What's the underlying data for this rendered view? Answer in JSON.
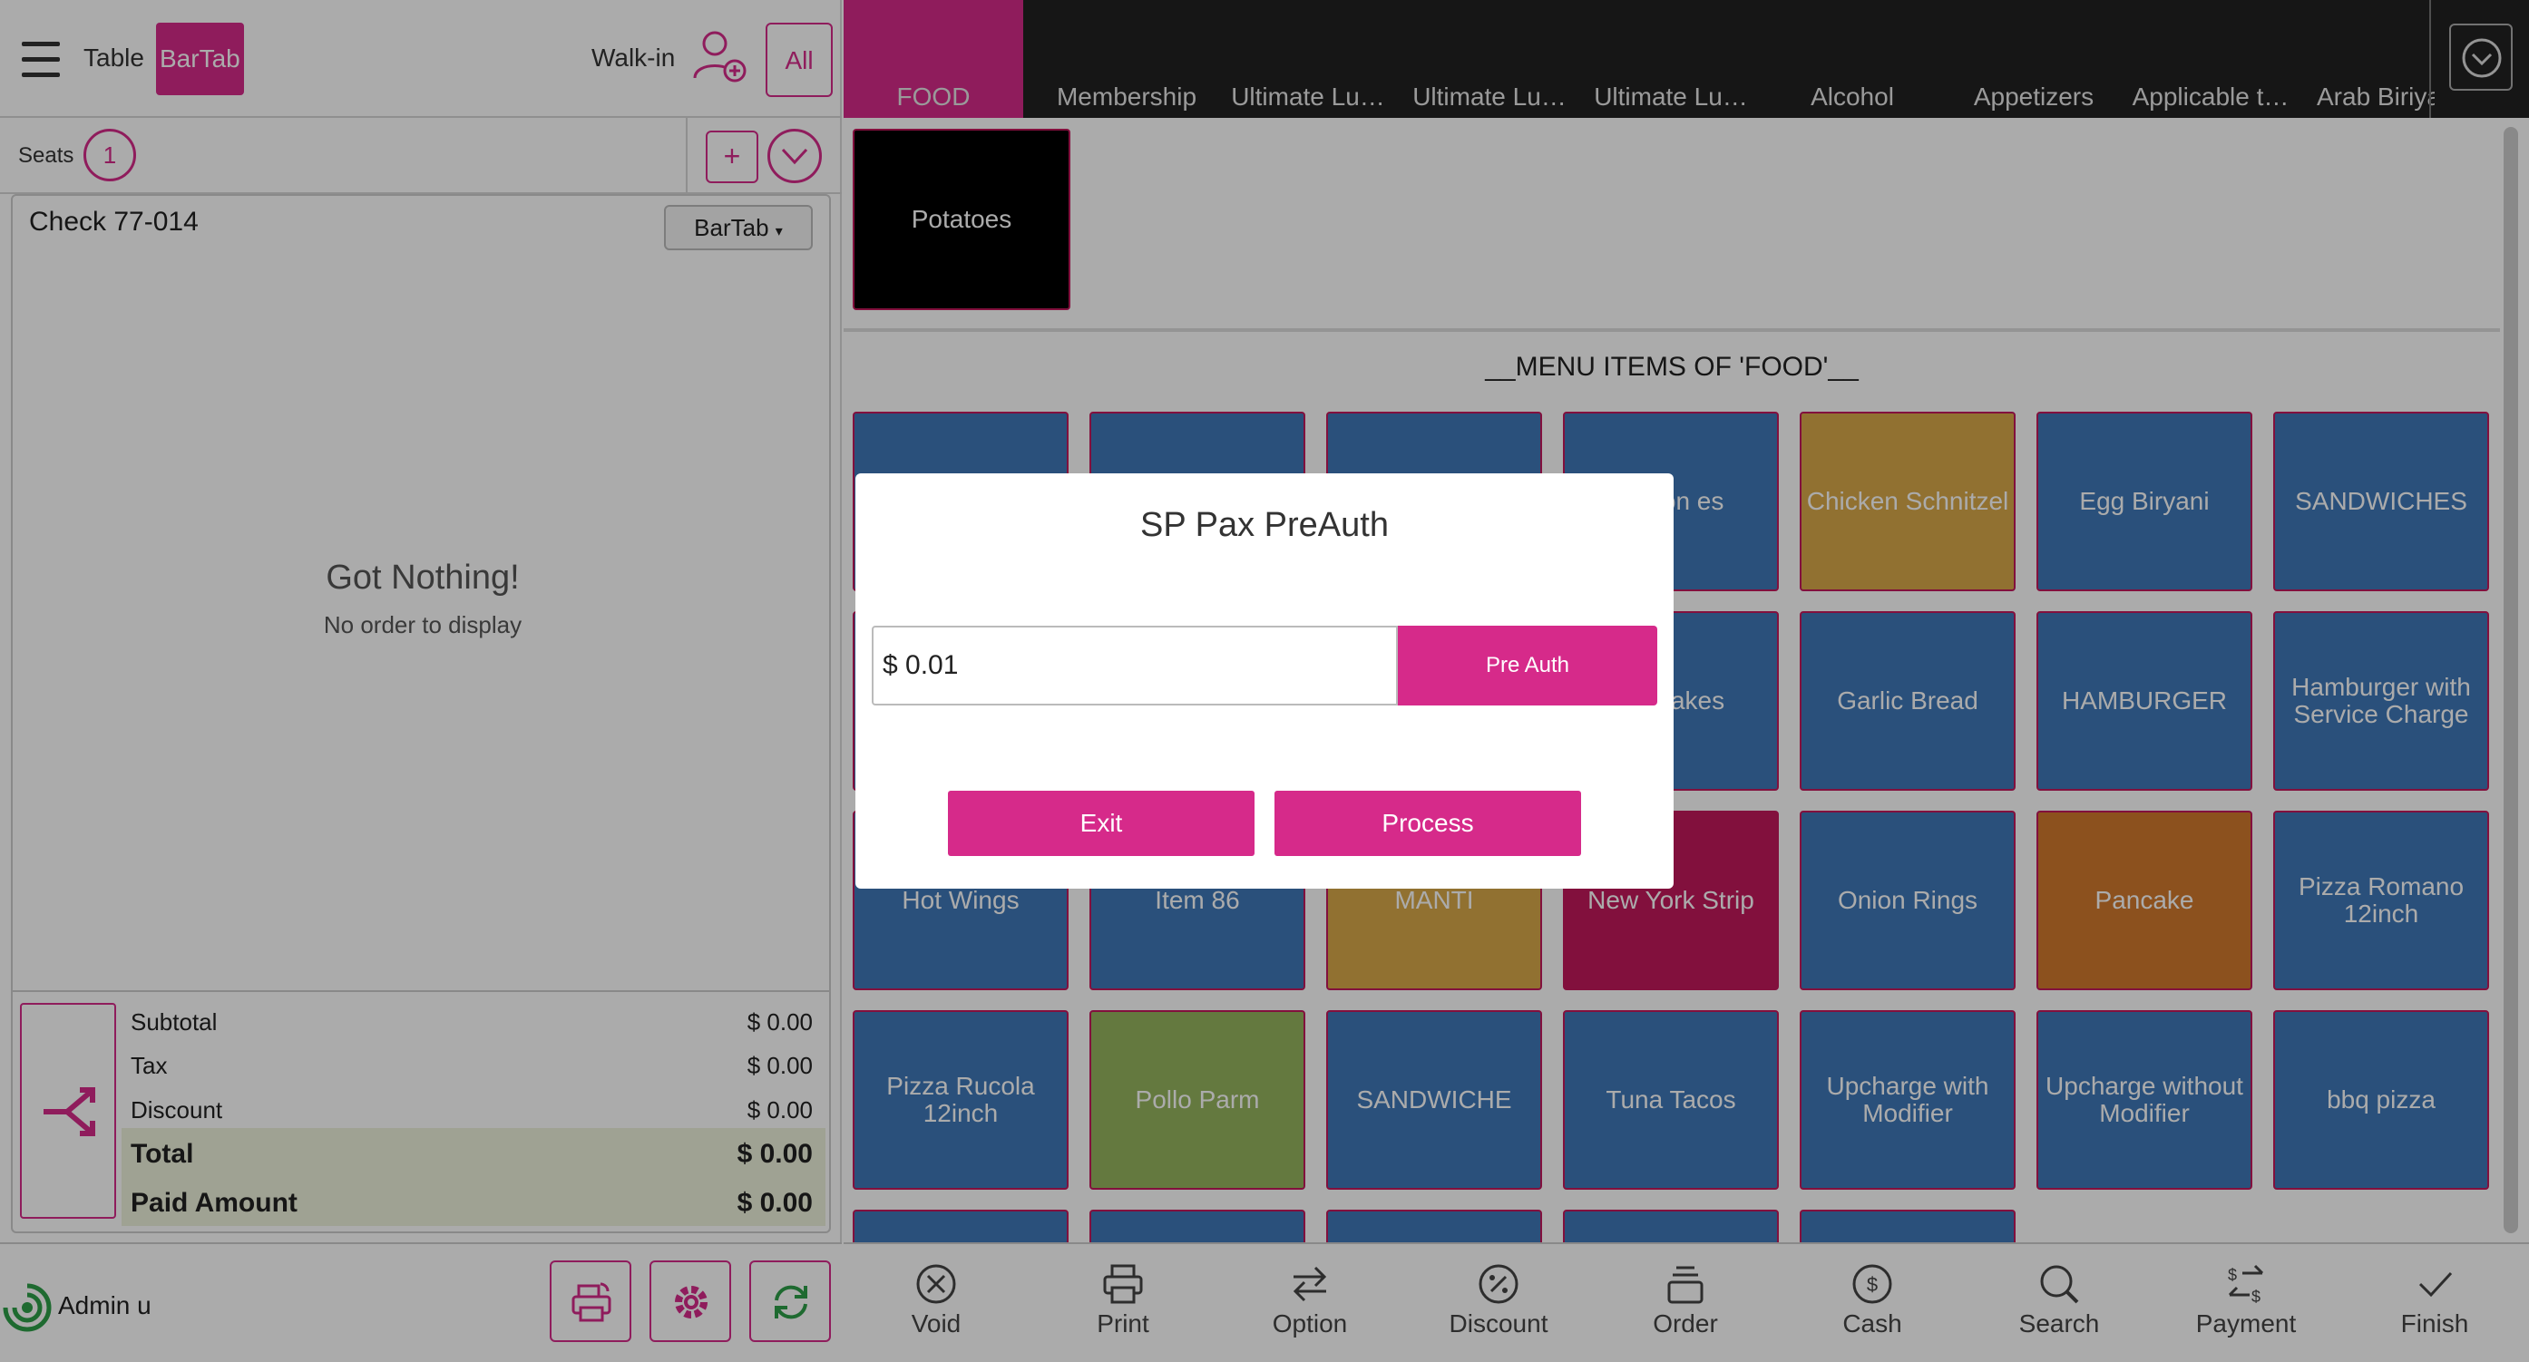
{
  "header": {
    "table_label": "Table",
    "bartab_label": "BarTab",
    "walkin_label": "Walk-in",
    "all_label": "All"
  },
  "seats": {
    "label": "Seats",
    "count": "1",
    "add_symbol": "+"
  },
  "check": {
    "title": "Check 77-014",
    "type": "BarTab",
    "empty_title": "Got Nothing!",
    "empty_sub": "No order to display"
  },
  "totals": {
    "subtotal_label": "Subtotal",
    "subtotal": "$ 0.00",
    "tax_label": "Tax",
    "tax": "$ 0.00",
    "discount_label": "Discount",
    "discount": "$ 0.00",
    "total_label": "Total",
    "total": "$ 0.00",
    "paid_label": "Paid Amount",
    "paid": "$ 0.00"
  },
  "user": {
    "name": "Admin u"
  },
  "tabs": [
    "FOOD",
    "Membership",
    "Ultimate Lu…",
    "Ultimate Lu…",
    "Ultimate Lu…",
    "Alcohol",
    "Appetizers",
    "Applicable t…",
    "Arab Biriya"
  ],
  "category": {
    "item": "Potatoes"
  },
  "menu": {
    "heading": "__MENU ITEMS OF 'FOOD'__",
    "items": [
      {
        "label": "",
        "color": "#3f78b8"
      },
      {
        "label": "",
        "color": "#3f78b8"
      },
      {
        "label": "",
        "color": "#3f78b8"
      },
      {
        "label": "Bacon es",
        "color": "#3f78b8"
      },
      {
        "label": "Chicken Schnitzel",
        "color": "#d8a94a"
      },
      {
        "label": "Egg Biryani",
        "color": "#3f78b8"
      },
      {
        "label": "SANDWICHES",
        "color": "#3f78b8"
      },
      {
        "label": "",
        "color": "#3f78b8"
      },
      {
        "label": "",
        "color": "#3f78b8"
      },
      {
        "label": "",
        "color": "#3f78b8"
      },
      {
        "label": "ab Cakes",
        "color": "#3f78b8"
      },
      {
        "label": "Garlic Bread",
        "color": "#3f78b8"
      },
      {
        "label": "HAMBURGER",
        "color": "#3f78b8"
      },
      {
        "label": "Hamburger with Service Charge",
        "color": "#3f78b8"
      },
      {
        "label": "Hot Wings",
        "color": "#3f78b8"
      },
      {
        "label": "Item 86",
        "color": "#3f78b8"
      },
      {
        "label": "MANTI",
        "color": "#d8a94a"
      },
      {
        "label": "New York Strip",
        "color": "#c2185b"
      },
      {
        "label": "Onion Rings",
        "color": "#3f78b8"
      },
      {
        "label": "Pancake",
        "color": "#d17a2d"
      },
      {
        "label": "Pizza Romano 12inch",
        "color": "#3f78b8"
      },
      {
        "label": "Pizza Rucola 12inch",
        "color": "#3f78b8"
      },
      {
        "label": "Pollo Parm",
        "color": "#95b55e"
      },
      {
        "label": "SANDWICHE",
        "color": "#3f78b8"
      },
      {
        "label": "Tuna Tacos",
        "color": "#3f78b8"
      },
      {
        "label": "Upcharge with Modifier",
        "color": "#3f78b8"
      },
      {
        "label": "Upcharge without Modifier",
        "color": "#3f78b8"
      },
      {
        "label": "bbq pizza",
        "color": "#3f78b8"
      }
    ]
  },
  "actions": [
    "Void",
    "Print",
    "Option",
    "Discount",
    "Order",
    "Cash",
    "Search",
    "Payment",
    "Finish"
  ],
  "modal": {
    "title": "SP Pax PreAuth",
    "amount_value": "$ 0.01",
    "preauth_label": "Pre Auth",
    "exit_label": "Exit",
    "process_label": "Process"
  },
  "colors": {
    "accent": "#d62a8a",
    "tile_blue": "#3f78b8"
  }
}
